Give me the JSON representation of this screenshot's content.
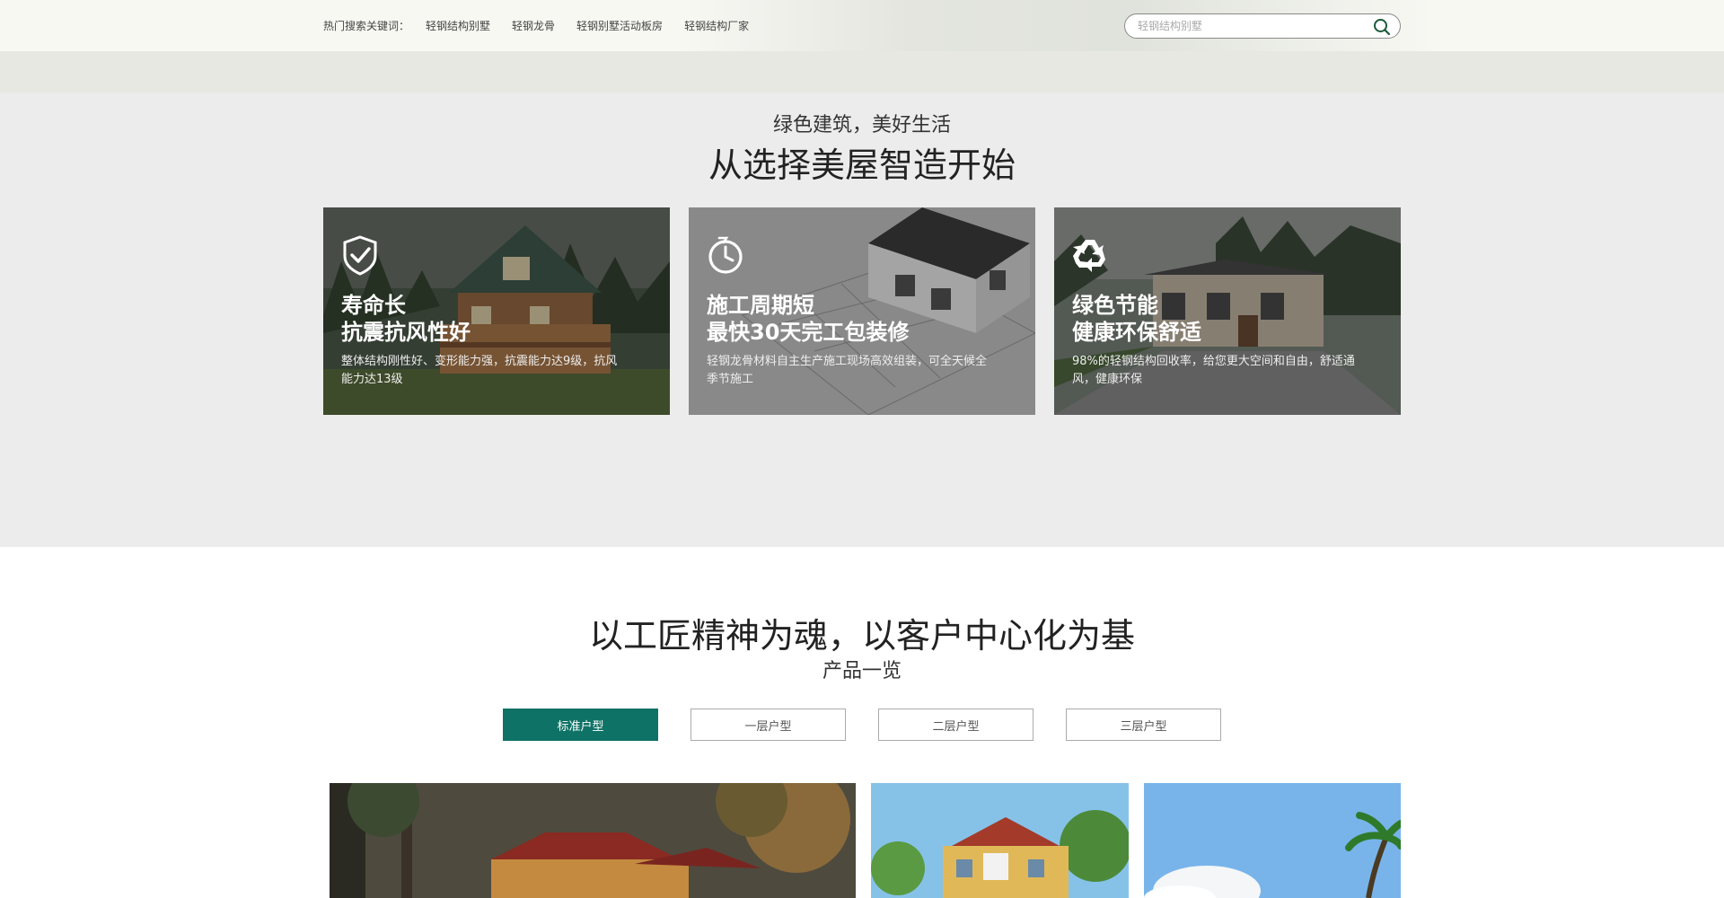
{
  "topbar": {
    "hot_label": "热门搜索关键词：",
    "keywords": [
      "轻钢结构别墅",
      "轻钢龙骨",
      "轻钢别墅活动板房",
      "轻钢结构厂家"
    ],
    "search_placeholder": "轻钢结构别墅"
  },
  "section1": {
    "subtitle": "绿色建筑，美好生活",
    "title": "从选择美屋智造开始",
    "cards": [
      {
        "icon": "shield-check-icon",
        "h1": "寿命长",
        "h2": "抗震抗风性好",
        "desc": "整体结构刚性好、变形能力强，抗震能力达9级，抗风能力达13级"
      },
      {
        "icon": "clock-icon",
        "h1": "施工周期短",
        "h2": "最快30天完工包装修",
        "desc": "轻钢龙骨材料自主生产施工现场高效组装，可全天候全季节施工"
      },
      {
        "icon": "recycle-icon",
        "h1": "绿色节能",
        "h2": "健康环保舒适",
        "desc": "98%的轻钢结构回收率，给您更大空间和自由，舒适通风，健康环保"
      }
    ]
  },
  "section2": {
    "title": "以工匠精神为魂，以客户中心化为基",
    "subtitle": "产品一览",
    "tabs": [
      "标准户型",
      "一层户型",
      "二层户型",
      "三层户型"
    ]
  },
  "colors": {
    "accent": "#0f7266",
    "icon_green": "#1a5a3a"
  }
}
